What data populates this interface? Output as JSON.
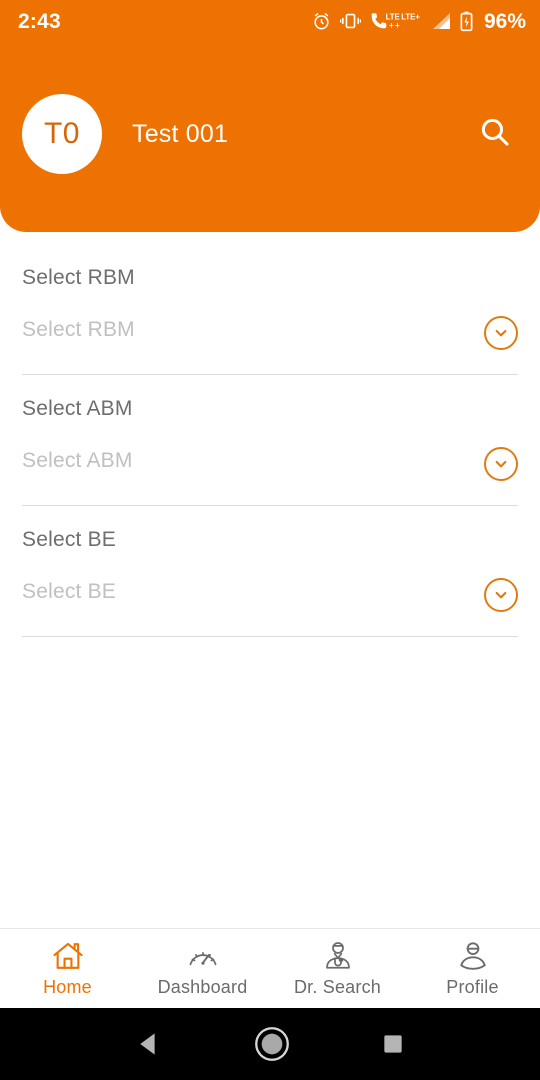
{
  "theme": {
    "primary": "#ee7202",
    "accent": "#e07b12",
    "label_color": "#6e6e6e",
    "placeholder_color": "#c0c0c0",
    "background": "#ffffff",
    "sysnav_background": "#000000"
  },
  "statusbar": {
    "time": "2:43",
    "battery_percent": "96%",
    "icons": [
      "alarm-icon",
      "vibrate-icon",
      "call-lte-icon",
      "lte-plus-icon",
      "signal-bars-icon",
      "battery-charging-icon"
    ]
  },
  "header": {
    "avatar_initials": "T0",
    "title": "Test 001",
    "search_icon": "search-icon"
  },
  "form": {
    "fields": [
      {
        "label": "Select RBM",
        "placeholder": "Select RBM",
        "value": "",
        "chevron_icon": "chevron-down-icon"
      },
      {
        "label": "Select ABM",
        "placeholder": "Select ABM",
        "value": "",
        "chevron_icon": "chevron-down-icon"
      },
      {
        "label": "Select BE",
        "placeholder": "Select BE",
        "value": "",
        "chevron_icon": "chevron-down-icon"
      }
    ]
  },
  "bottom_nav": {
    "items": [
      {
        "label": "Home",
        "icon": "home-icon",
        "active": true
      },
      {
        "label": "Dashboard",
        "icon": "speedometer-icon",
        "active": false
      },
      {
        "label": "Dr. Search",
        "icon": "doctor-icon",
        "active": false
      },
      {
        "label": "Profile",
        "icon": "person-icon",
        "active": false
      }
    ]
  },
  "system_nav": {
    "back_label": "Back",
    "home_label": "Home",
    "recents_label": "Recents"
  }
}
